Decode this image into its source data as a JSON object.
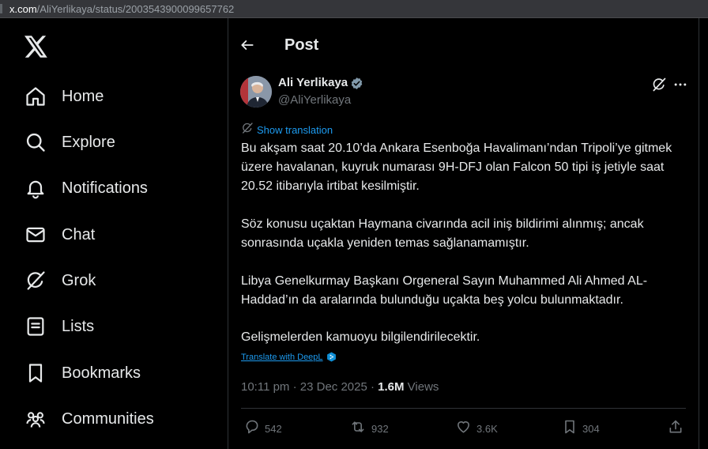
{
  "browser": {
    "url_host": "x.com",
    "url_path": "/AliYerlikaya/status/2003543900099657762"
  },
  "sidebar": {
    "logo": "x-logo-icon",
    "items": [
      {
        "label": "Home",
        "icon": "home-icon"
      },
      {
        "label": "Explore",
        "icon": "search-icon"
      },
      {
        "label": "Notifications",
        "icon": "bell-icon"
      },
      {
        "label": "Chat",
        "icon": "mail-icon"
      },
      {
        "label": "Grok",
        "icon": "grok-icon"
      },
      {
        "label": "Lists",
        "icon": "list-icon"
      },
      {
        "label": "Bookmarks",
        "icon": "bookmark-icon"
      },
      {
        "label": "Communities",
        "icon": "people-icon"
      }
    ]
  },
  "header": {
    "title": "Post"
  },
  "post": {
    "author_name": "Ali Yerlikaya",
    "author_handle": "@AliYerlikaya",
    "show_translation": "Show translation",
    "paragraphs": [
      "Bu akşam saat 20.10’da Ankara Esenboğa Havalimanı’ndan Tripoli’ye gitmek üzere havalanan, kuyruk numarası 9H-DFJ olan Falcon 50 tipi iş jetiyle saat 20.52 itibarıyla irtibat kesilmiştir.",
      "Söz konusu uçaktan Haymana civarında acil iniş bildirimi alınmış; ancak sonrasında uçakla yeniden temas sağlanamamıştır.",
      "Libya Genelkurmay Başkanı Orgeneral Sayın Muhammed Ali Ahmed AL-Haddad’ın da aralarında bulunduğu uçakta beş yolcu bulunmaktadır.",
      "Gelişmelerden kamuoyu bilgilendirilecektir."
    ],
    "deepl_label": "Translate with DeepL",
    "timestamp": "10:11 pm · 23 Dec 2025 · ",
    "views_count": "1.6M",
    "views_label": " Views",
    "actions": {
      "replies": "542",
      "reposts": "932",
      "likes": "3.6K",
      "bookmarks": "304"
    }
  },
  "colors": {
    "background": "#000000",
    "text": "#e7e9ea",
    "muted": "#71767b",
    "accent": "#1d9bf0",
    "border": "#2f3336"
  }
}
